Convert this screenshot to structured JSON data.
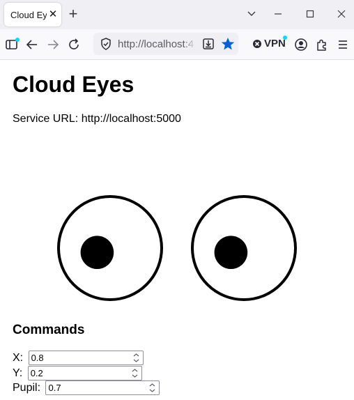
{
  "browser": {
    "tab_title": "Cloud Eyes",
    "url": "http://localhost:4...",
    "vpn_label": "VPN"
  },
  "page": {
    "title": "Cloud Eyes",
    "service_url_label": "Service URL: ",
    "service_url": "http://localhost:5000",
    "commands_heading": "Commands"
  },
  "eyes": {
    "left": {
      "pupil_x": 0.2,
      "pupil_y": 0.6,
      "pupil_size": 0.7
    },
    "right": {
      "pupil_x": 0.2,
      "pupil_y": 0.6,
      "pupil_size": 0.7
    }
  },
  "commands": {
    "x": {
      "label": "X:",
      "value": "0.8"
    },
    "y": {
      "label": "Y:",
      "value": "0.2"
    },
    "pupil": {
      "label": "Pupil:",
      "value": "0.7"
    }
  },
  "icons": {
    "tab_close": "close-icon",
    "new_tab": "plus-icon",
    "list_tabs": "chevron-down-icon",
    "minimize": "minimize-icon",
    "maximize": "maximize-icon",
    "close_window": "close-icon",
    "sidebar": "sidebar-icon",
    "back": "arrow-left-icon",
    "forward": "arrow-right-icon",
    "reload": "reload-icon",
    "site_info": "shield-icon",
    "save_page": "download-icon",
    "bookmark": "star-icon",
    "vpn": "vpn-icon",
    "account": "account-icon",
    "extensions": "puzzle-icon",
    "menu": "hamburger-menu-icon"
  },
  "colors": {
    "accent": "#0061e0",
    "badge": "#00ddff",
    "chrome": "#f0f0f4"
  }
}
